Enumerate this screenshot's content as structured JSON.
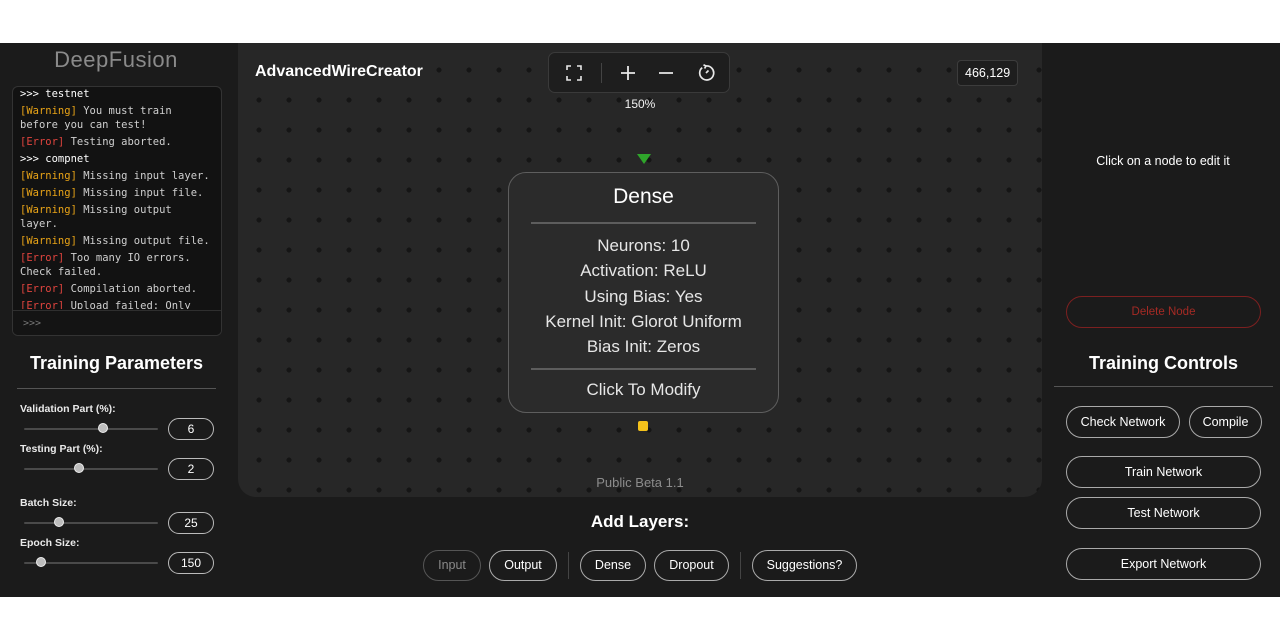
{
  "app": {
    "brand": "DeepFusion"
  },
  "console": {
    "lines": [
      {
        "type": "cmd",
        "text": ">>> testnet"
      },
      {
        "type": "warning",
        "tag": "Warning",
        "text": "You must train before you can test!"
      },
      {
        "type": "error",
        "tag": "Error",
        "text": "Testing aborted."
      },
      {
        "type": "cmd",
        "text": ">>> compnet"
      },
      {
        "type": "warning",
        "tag": "Warning",
        "text": "Missing input layer."
      },
      {
        "type": "warning",
        "tag": "Warning",
        "text": "Missing input file."
      },
      {
        "type": "warning",
        "tag": "Warning",
        "text": "Missing output layer."
      },
      {
        "type": "warning",
        "tag": "Warning",
        "text": "Missing output file."
      },
      {
        "type": "error",
        "tag": "Error",
        "text": "Too many IO errors. Check failed."
      },
      {
        "type": "error",
        "tag": "Error",
        "text": "Compilation aborted."
      },
      {
        "type": "error",
        "tag": "Error",
        "text": "Upload failed: Only"
      }
    ],
    "input_placeholder": ">>>"
  },
  "training_parameters": {
    "title": "Training Parameters",
    "params": [
      {
        "label": "Validation Part (%):",
        "value": "6",
        "slider_fraction": 0.59
      },
      {
        "label": "Testing Part (%):",
        "value": "2",
        "slider_fraction": 0.41
      },
      {
        "label": "Batch Size:",
        "value": "25",
        "slider_fraction": 0.26
      },
      {
        "label": "Epoch Size:",
        "value": "150",
        "slider_fraction": 0.13
      }
    ]
  },
  "canvas": {
    "title": "AdvancedWireCreator",
    "zoom": "150%",
    "coords": "466,129",
    "toolbar_icons": [
      "fit-screen-icon",
      "zoom-in-icon",
      "zoom-out-icon",
      "reset-view-icon"
    ],
    "footer": "Public Beta 1.1",
    "node": {
      "title": "Dense",
      "props": [
        "Neurons: 10",
        "Activation: ReLU",
        "Using Bias: Yes",
        "Kernel Init: Glorot Uniform",
        "Bias Init: Zeros"
      ],
      "action": "Click To Modify",
      "colors": {
        "input_port": "#2fa52b",
        "output_port": "#f4c21b"
      }
    }
  },
  "add_layers": {
    "title": "Add Layers:",
    "buttons": {
      "input": "Input",
      "output": "Output",
      "dense": "Dense",
      "dropout": "Dropout",
      "suggestions": "Suggestions?"
    }
  },
  "right_panel": {
    "hint": "Click on a node to edit it",
    "delete_label": "Delete Node",
    "controls_title": "Training Controls",
    "buttons": {
      "check": "Check Network",
      "compile": "Compile",
      "train": "Train Network",
      "test": "Test Network",
      "export": "Export Network"
    },
    "colors": {
      "delete": "#a52a24"
    }
  }
}
